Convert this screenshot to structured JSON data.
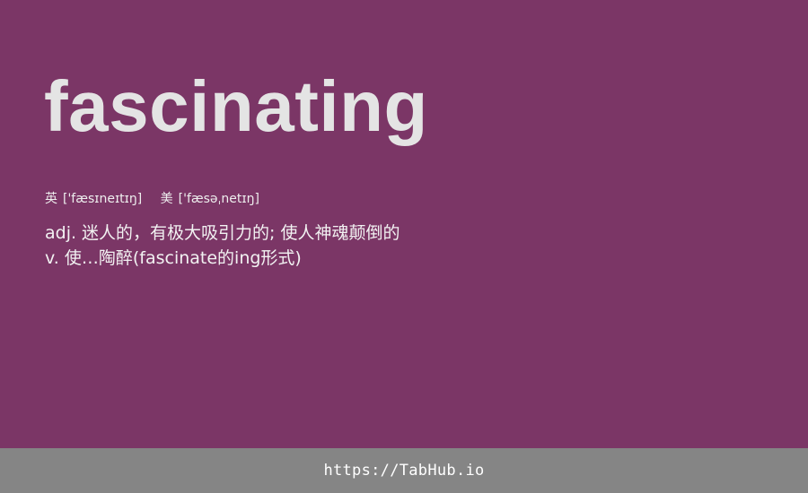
{
  "word": "fascinating",
  "phonetics": {
    "uk": {
      "region": "英",
      "ipa": "['fæsɪneɪtɪŋ]"
    },
    "us": {
      "region": "美",
      "ipa": "['fæsəˌnetɪŋ]"
    }
  },
  "definitions": [
    "adj. 迷人的，有极大吸引力的; 使人神魂颠倒的",
    "v. 使…陶醉(fascinate的ing形式)"
  ],
  "footer": {
    "link_text": "https://TabHub.io"
  },
  "colors": {
    "background": "#7b3666",
    "footer_bar": "#858585",
    "word_text": "#e4e4e4"
  }
}
